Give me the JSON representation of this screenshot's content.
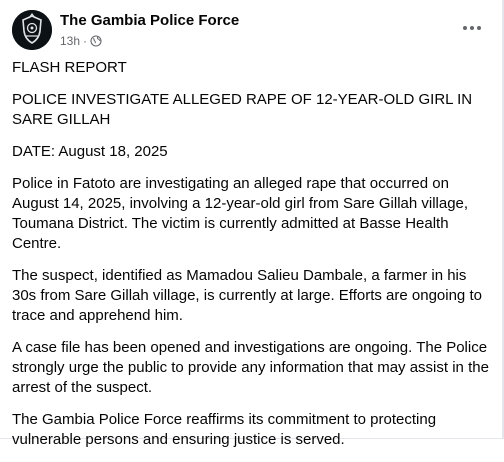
{
  "post": {
    "author": "The Gambia Police Force",
    "time": "13h",
    "separator": "·",
    "privacy_icon": "globe-icon",
    "more_icon": "more-options-icon",
    "avatar_icon": "police-crest-icon",
    "paragraphs": [
      "FLASH REPORT",
      "POLICE INVESTIGATE ALLEGED RAPE OF 12-YEAR-OLD GIRL IN SARE GILLAH",
      "DATE: August 18, 2025",
      "Police in Fatoto are investigating an alleged rape that occurred on August 14, 2025, involving a 12-year-old girl from Sare Gillah village, Toumana District. The victim is currently admitted at Basse Health Centre.",
      "The suspect, identified as Mamadou Salieu Dambale, a farmer in his 30s from Sare Gillah village, is currently at large. Efforts are ongoing to trace and apprehend him.",
      "A case file has been opened and investigations are ongoing. The Police strongly urge the public to provide any information that may assist in the arrest of the suspect.",
      "The Gambia Police Force reaffirms its commitment to protecting vulnerable persons and ensuring justice is served."
    ]
  },
  "colors": {
    "text": "#050505",
    "secondary_text": "#65676b",
    "avatar_bg": "#0c1116",
    "crest": "#dfe3e8"
  }
}
